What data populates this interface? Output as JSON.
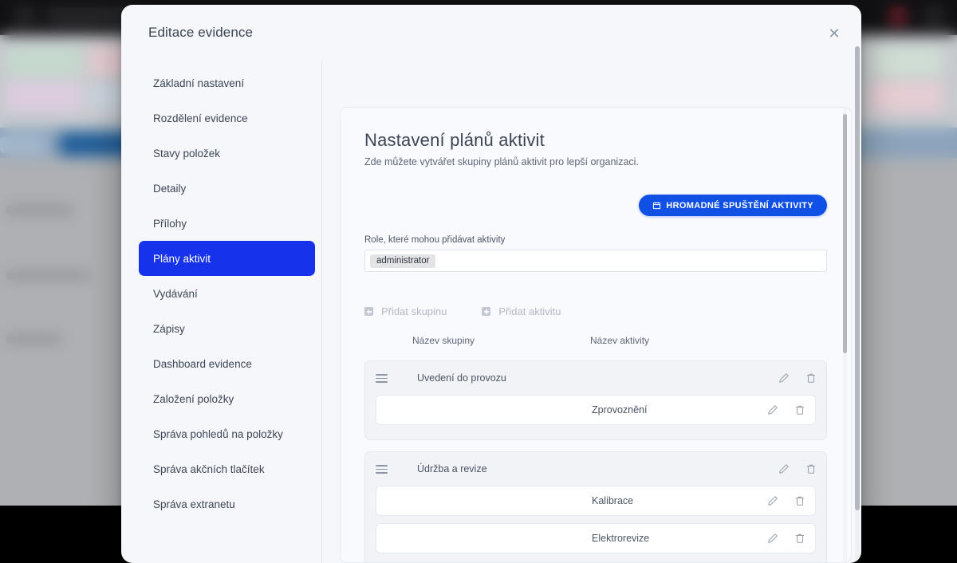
{
  "modal": {
    "title": "Editace evidence",
    "close_label": "✕"
  },
  "sidebar": {
    "items": [
      {
        "label": "Základní nastavení",
        "active": false
      },
      {
        "label": "Rozdělení evidence",
        "active": false
      },
      {
        "label": "Stavy položek",
        "active": false
      },
      {
        "label": "Detaily",
        "active": false
      },
      {
        "label": "Přílohy",
        "active": false
      },
      {
        "label": "Plány aktivit",
        "active": true
      },
      {
        "label": "Vydávání",
        "active": false
      },
      {
        "label": "Zápisy",
        "active": false
      },
      {
        "label": "Dashboard evidence",
        "active": false
      },
      {
        "label": "Založení položky",
        "active": false
      },
      {
        "label": "Správa pohledů na položky",
        "active": false
      },
      {
        "label": "Správa akčních tlačítek",
        "active": false
      },
      {
        "label": "Správa extranetu",
        "active": false
      }
    ]
  },
  "panel": {
    "title": "Nastavení plánů aktivit",
    "subtitle": "Zde můžete vytvářet skupiny plánů aktivit pro lepší organizaci.",
    "bulk_button": "HROMADNÉ SPUŠTĚNÍ AKTIVITY",
    "roles_label": "Role, které mohou přidávat aktivity",
    "roles_tokens": [
      "administrator"
    ],
    "add_group": "Přidat skupinu",
    "add_activity": "Přidat aktivitu",
    "columns": {
      "group": "Název skupiny",
      "activity": "Název aktivity"
    },
    "groups": [
      {
        "name": "Uvedení do provozu",
        "activities": [
          {
            "name": "Zprovoznění"
          }
        ]
      },
      {
        "name": "Údržba a revize",
        "activities": [
          {
            "name": "Kalibrace"
          },
          {
            "name": "Elektrorevize"
          }
        ]
      }
    ]
  },
  "colors": {
    "accent_active": "#1633eb",
    "accent_button": "#1150e4",
    "modal_bg": "#f6f7fb",
    "panel_bg": "#f9fafd",
    "group_bg": "#f1f3f7"
  }
}
